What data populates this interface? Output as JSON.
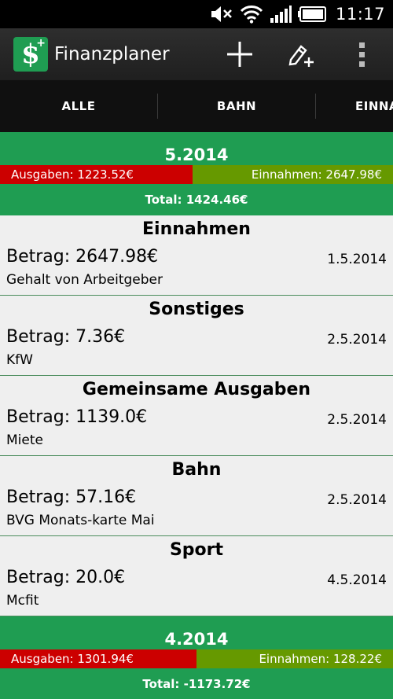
{
  "status_bar": {
    "time": "11:17",
    "icons": [
      "mute-icon",
      "wifi-icon",
      "signal-icon",
      "battery-icon"
    ]
  },
  "action_bar": {
    "title": "Finanzplaner",
    "actions": [
      "add-icon",
      "edit-add-icon",
      "overflow-menu-icon"
    ]
  },
  "tabs": {
    "items": [
      {
        "label": "ALLE",
        "selected": true
      },
      {
        "label": "BAHN",
        "selected": false
      },
      {
        "label": "EINNA",
        "selected": false
      }
    ]
  },
  "months": [
    {
      "title": "5.2014",
      "ausgaben": "Ausgaben: 1223.52€",
      "einnahmen": "Einnahmen: 2647.98€",
      "total": "Total: 1424.46€",
      "entries": [
        {
          "category": "Einnahmen",
          "amount": "Betrag: 2647.98€",
          "date": "1.5.2014",
          "description": "Gehalt von Arbeitgeber"
        },
        {
          "category": "Sonstiges",
          "amount": "Betrag: 7.36€",
          "date": "2.5.2014",
          "description": "KfW"
        },
        {
          "category": "Gemeinsame Ausgaben",
          "amount": "Betrag: 1139.0€",
          "date": "2.5.2014",
          "description": "Miete"
        },
        {
          "category": "Bahn",
          "amount": "Betrag: 57.16€",
          "date": "2.5.2014",
          "description": "BVG Monats-karte Mai"
        },
        {
          "category": "Sport",
          "amount": "Betrag: 20.0€",
          "date": "4.5.2014",
          "description": "Mcfit"
        }
      ]
    },
    {
      "title": "4.2014",
      "ausgaben": "Ausgaben: 1301.94€",
      "einnahmen": "Einnahmen: 128.22€",
      "total": "Total: -1173.72€",
      "entries": []
    }
  ],
  "colors": {
    "primary_green": "#1f9d52",
    "expense_red": "#cc0000",
    "income_olive": "#669900",
    "tab_indicator": "#33b5e5"
  }
}
